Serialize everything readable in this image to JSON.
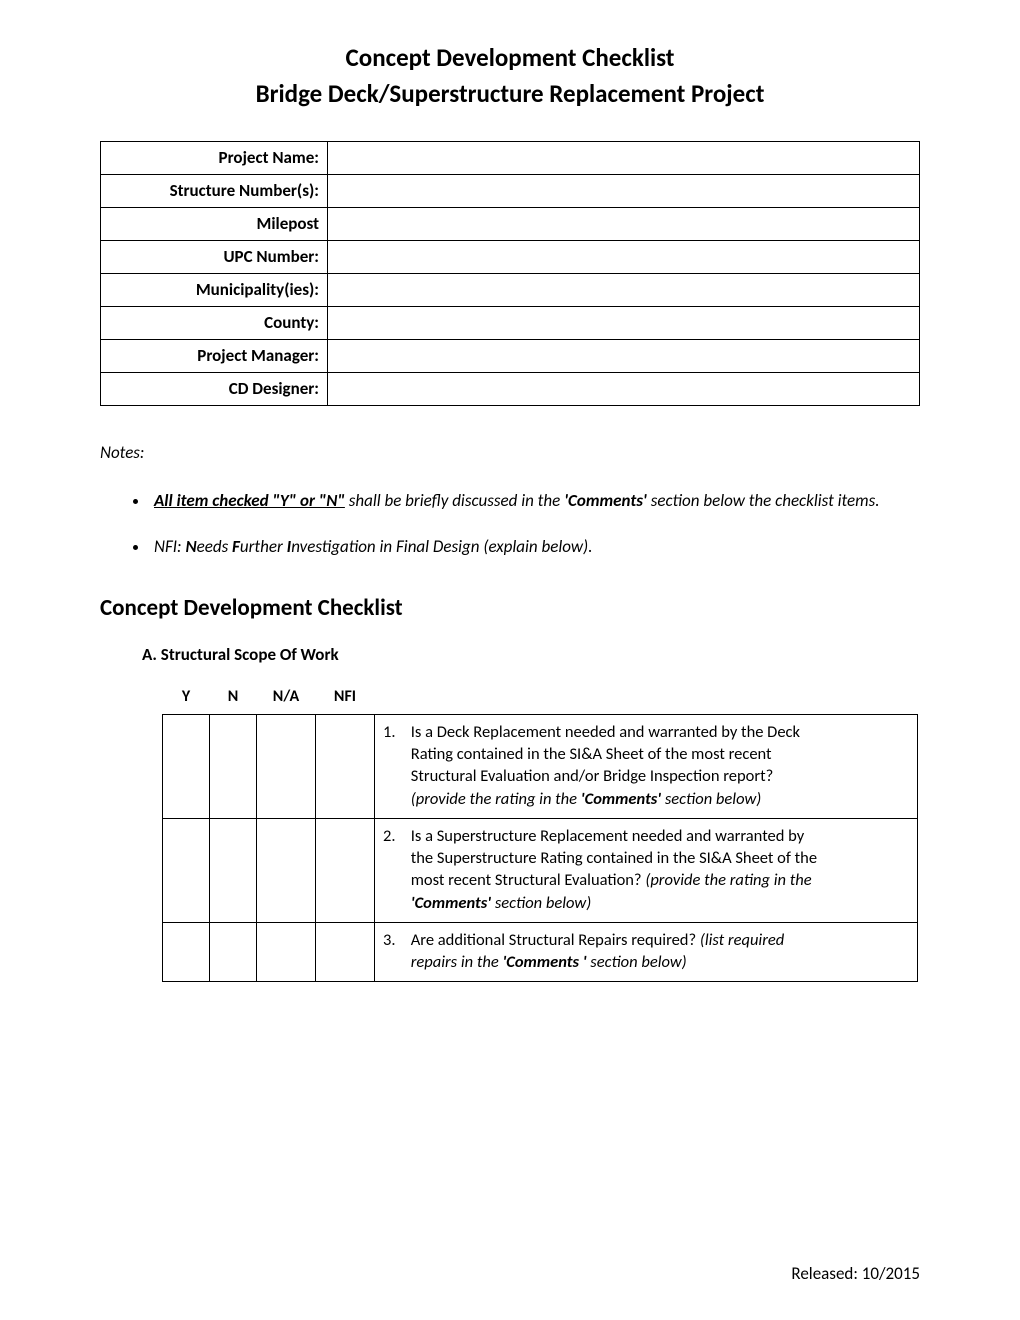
{
  "title": {
    "line1": "Concept Development Checklist",
    "line2": "Bridge Deck/Superstructure Replacement Project"
  },
  "info_rows": [
    {
      "label": "Project Name:",
      "value": ""
    },
    {
      "label": "Structure Number(s):",
      "value": ""
    },
    {
      "label": "Milepost",
      "value": ""
    },
    {
      "label": "UPC Number:",
      "value": ""
    },
    {
      "label": "Municipality(ies):",
      "value": ""
    },
    {
      "label": "County:",
      "value": ""
    },
    {
      "label": "Project Manager:",
      "value": ""
    },
    {
      "label": "CD Designer:",
      "value": ""
    }
  ],
  "notes_heading": "Notes:",
  "notes": {
    "n1_pre": "All item checked \"Y\" or \"N\"",
    "n1_mid": " shall be briefly discussed in the ",
    "n1_comm": "'Comments'",
    "n1_post": " section below the checklist items.",
    "n2_pre": "NFI:  ",
    "n2_N": "N",
    "n2_eeds": "eeds ",
    "n2_F": "F",
    "n2_urther": "urther ",
    "n2_I": "I",
    "n2_rest": "nvestigation in Final Design (explain below)."
  },
  "section_heading": "Concept Development Checklist",
  "sub_heading": "A.  Structural Scope Of Work",
  "cols": {
    "y": "Y",
    "n": "N",
    "na": "N/A",
    "nfi": "NFI"
  },
  "items": [
    {
      "num": "1.",
      "text_a": "Is a Deck Replacement needed and warranted by the Deck Rating contained in the SI&A Sheet of the most recent Structural Evaluation and/or Bridge Inspection report?  ",
      "ital_a": "(provide the rating in the ",
      "bold_a": "'Comments'",
      "ital_b": " section below)"
    },
    {
      "num": "2.",
      "text_a": "Is a Superstructure Replacement needed and warranted by the Superstructure Rating contained in the SI&A Sheet of the most recent Structural Evaluation? ",
      "ital_a": "(provide the rating in the ",
      "bold_a": "'Comments'",
      "ital_b": " section below)"
    },
    {
      "num": "3.",
      "text_a": "Are additional Structural Repairs required?  ",
      "ital_a": "(list required repairs in the ",
      "bold_a": "'Comments '",
      "ital_b": " section below)"
    }
  ],
  "footer": "Released: 10/2015"
}
